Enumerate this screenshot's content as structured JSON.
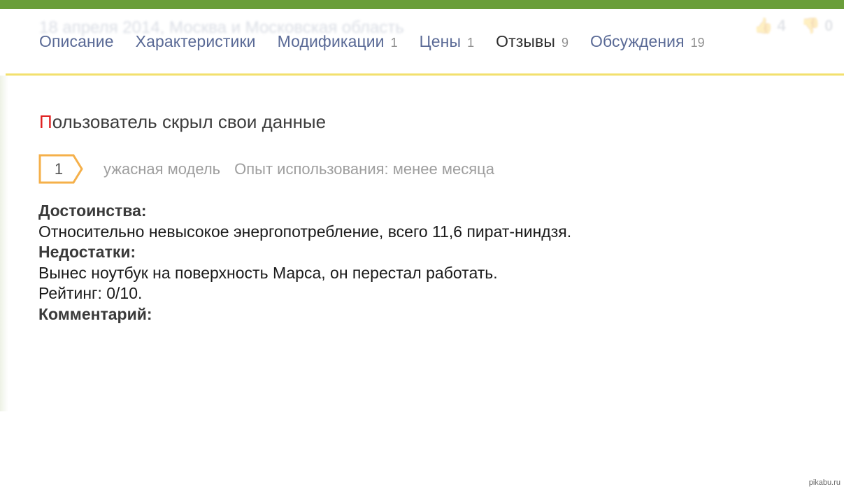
{
  "header": {
    "ghost_date": "18 апреля 2014, Москва и Московская область",
    "stats": [
      {
        "icon": "thumbs-up-icon",
        "glyph": "👍",
        "value": "4"
      },
      {
        "icon": "thumbs-down-icon",
        "glyph": "👎",
        "value": "0"
      }
    ]
  },
  "tabs": [
    {
      "label": "Описание",
      "count": ""
    },
    {
      "label": "Характеристики",
      "count": ""
    },
    {
      "label": "Модификации",
      "count": "1"
    },
    {
      "label": "Цены",
      "count": "1"
    },
    {
      "label": "Отзывы",
      "count": "9",
      "active": true
    },
    {
      "label": "Обсуждения",
      "count": "19"
    }
  ],
  "review": {
    "author_first_letter": "П",
    "author_rest": "ользователь скрыл свои данные",
    "rating": "1",
    "title": "ужасная модель",
    "experience": "Опыт использования: менее месяца",
    "pros_heading": "Достоинства:",
    "pros_text": "Относительно невысокое энергопотребление, всего 11,6 пират-ниндзя.",
    "cons_heading": "Недостатки:",
    "cons_text": "Вынес ноутбук на поверхность Марса, он перестал работать.",
    "rating_line": "Рейтинг: 0/10.",
    "comment_heading": "Комментарий:"
  },
  "watermark": "pikabu.ru",
  "colors": {
    "topbar": "#6a9e3a",
    "tab_link": "#5a6a96",
    "underline": "#f2e06e",
    "badge_border": "#f5b04a",
    "author_accent": "#e02020"
  }
}
